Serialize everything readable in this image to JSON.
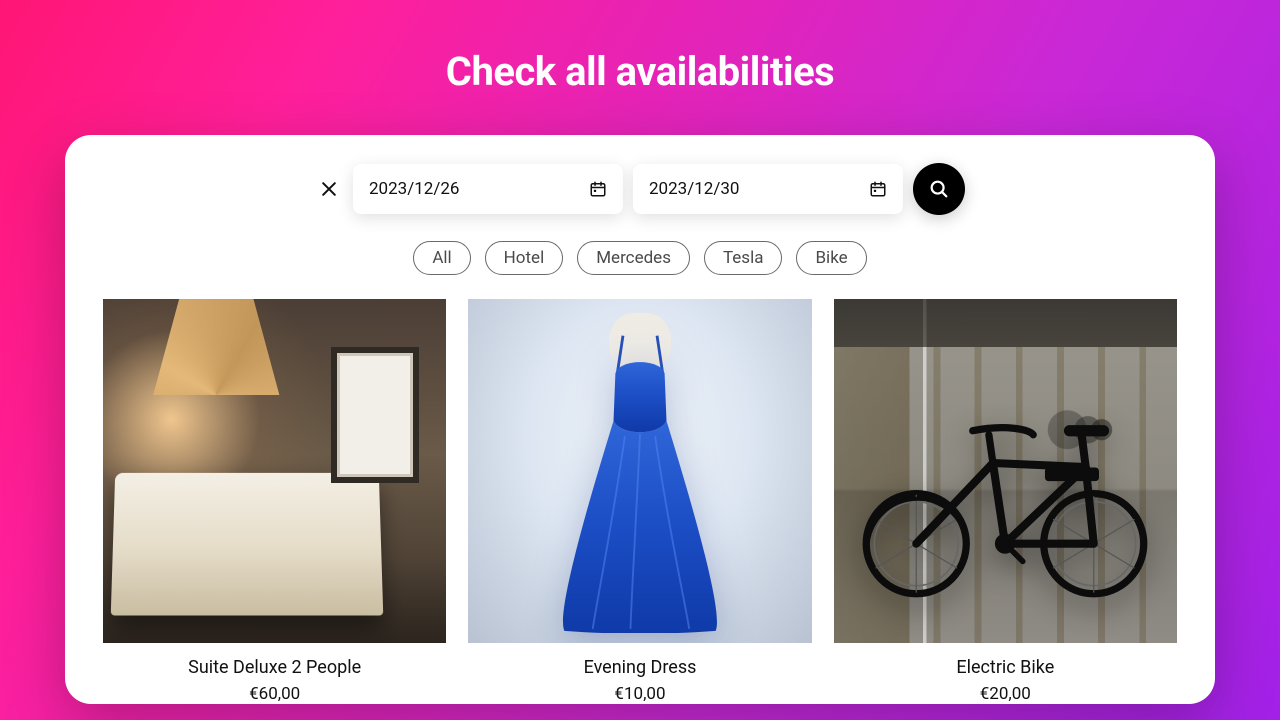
{
  "header": {
    "title": "Check all availabilities"
  },
  "search": {
    "start_date": "2023/12/26",
    "end_date": "2023/12/30"
  },
  "filters": {
    "items": [
      {
        "label": "All"
      },
      {
        "label": "Hotel"
      },
      {
        "label": "Mercedes"
      },
      {
        "label": "Tesla"
      },
      {
        "label": "Bike"
      }
    ]
  },
  "products": [
    {
      "title": "Suite Deluxe 2 People",
      "price": "€60,00"
    },
    {
      "title": "Evening Dress",
      "price": "€10,00"
    },
    {
      "title": "Electric Bike",
      "price": "€20,00"
    }
  ]
}
